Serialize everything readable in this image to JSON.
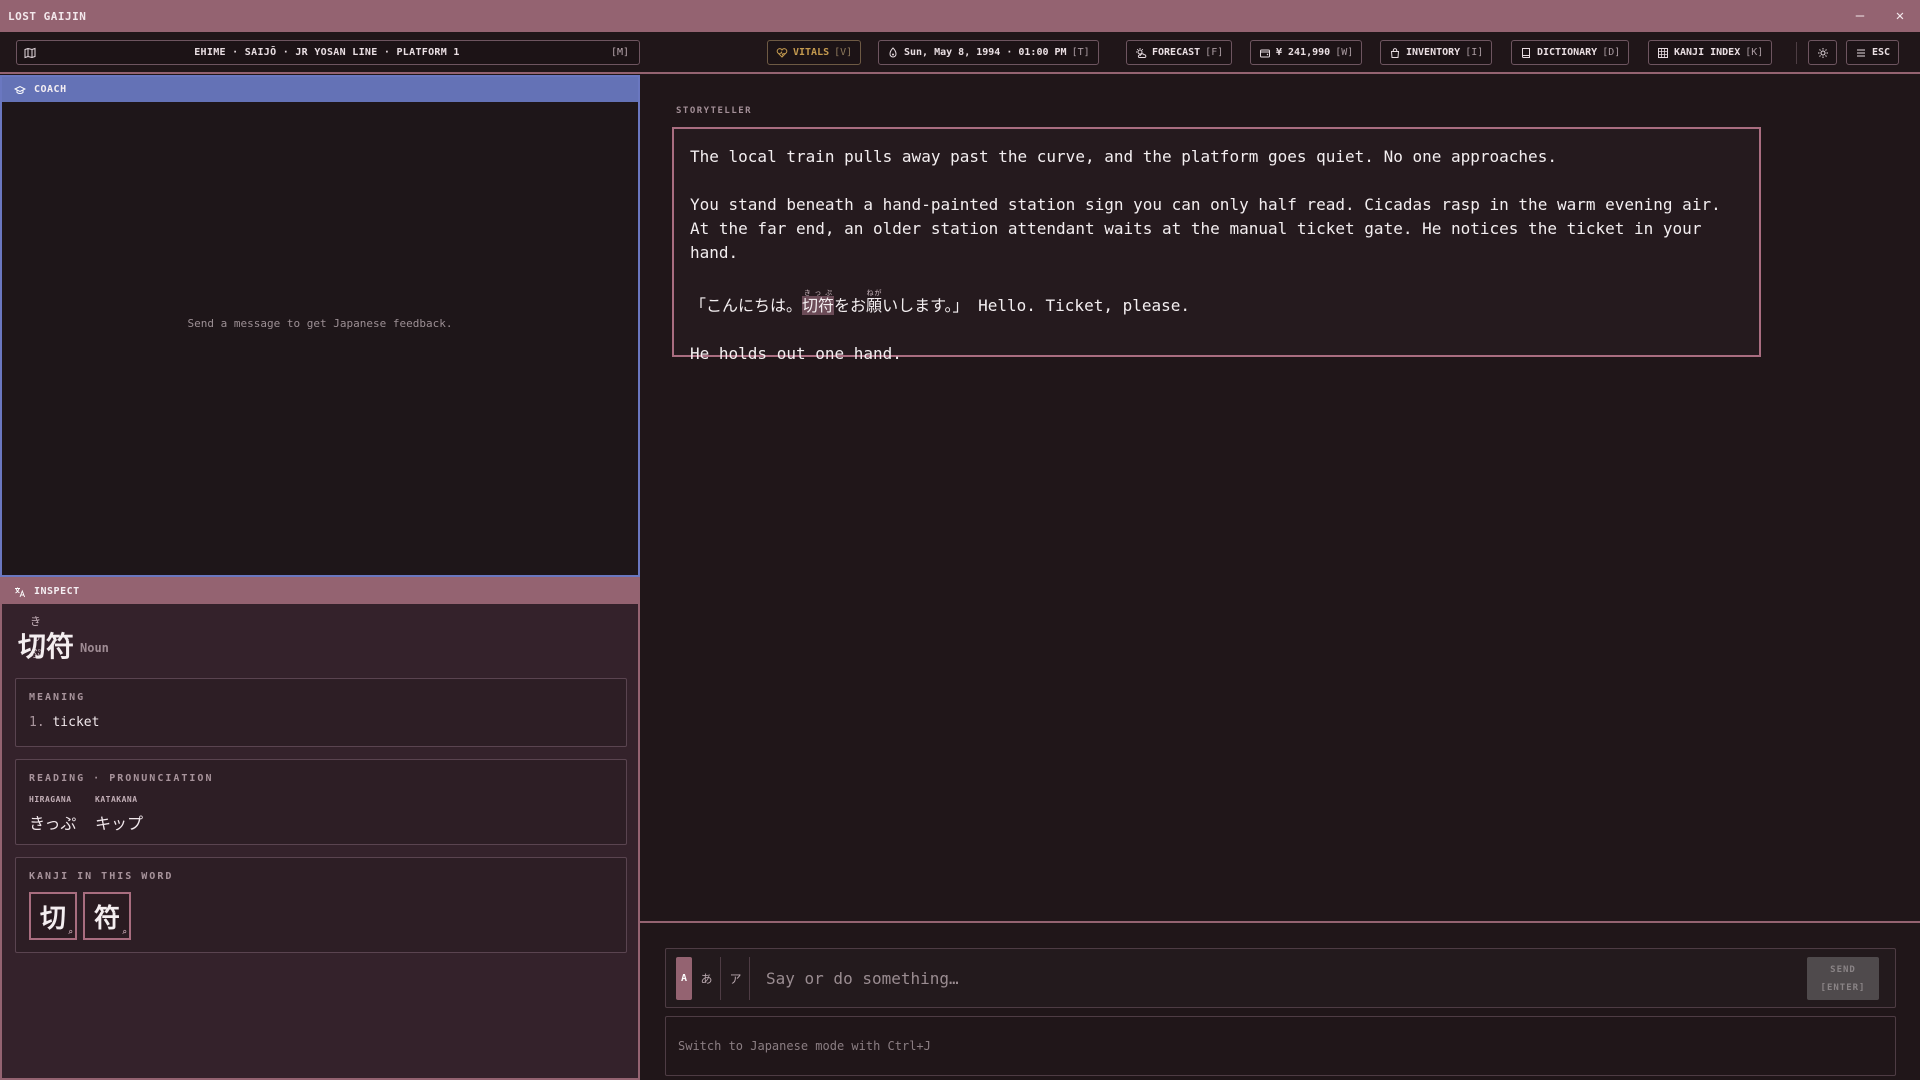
{
  "window": {
    "title": "LOST GAIJIN",
    "minimize_glyph": "—",
    "close_glyph": "✕"
  },
  "toolbar": {
    "location": {
      "text": "EHIME · SAIJŌ · JR YOSAN LINE · PLATFORM 1",
      "key": "[M]",
      "icon": "map-icon"
    },
    "vitals": {
      "label": "VITALS",
      "key": "[V]",
      "icon": "heart-icon",
      "color": "#c49a4f"
    },
    "time": {
      "label": "Sun, May 8, 1994 · 01:00 PM",
      "key": "[T]",
      "icon": "clock-icon"
    },
    "forecast": {
      "label": "FORECAST",
      "key": "[F]",
      "icon": "sun-cloud-icon"
    },
    "wallet": {
      "label": "¥ 241,990",
      "key": "[W]",
      "icon": "wallet-icon"
    },
    "inventory": {
      "label": "INVENTORY",
      "key": "[I]",
      "icon": "bag-icon"
    },
    "dictionary": {
      "label": "DICTIONARY",
      "key": "[D]",
      "icon": "book-icon"
    },
    "kanji_index": {
      "label": "KANJI INDEX",
      "key": "[K]",
      "icon": "grid-icon"
    },
    "settings": {
      "icon": "gear-icon"
    },
    "menu": {
      "label": "ESC",
      "icon": "menu-icon"
    }
  },
  "coach": {
    "title": "COACH",
    "icon": "graduation-cap-icon",
    "empty_text": "Send a message to get Japanese feedback.",
    "header_color": "#6472b6"
  },
  "inspect": {
    "title": "INSPECT",
    "icon": "translate-icon",
    "word": {
      "reading": "きっぷ",
      "kanji": "切符",
      "pos": "Noun"
    },
    "meaning": {
      "title": "MEANING",
      "items": [
        {
          "num": "1.",
          "text": "ticket"
        }
      ]
    },
    "reading": {
      "title": "READING · PRONUNCIATION",
      "hiragana_label": "HIRAGANA",
      "hiragana": "きっぷ",
      "katakana_label": "KATAKANA",
      "katakana": "キップ"
    },
    "kanji_section": {
      "title": "KANJI IN THIS WORD",
      "kanji": [
        "切",
        "符"
      ],
      "icon": "search-icon"
    }
  },
  "storyteller": {
    "label": "STORYTELLER",
    "p1": "The local train pulls away past the curve, and the platform goes quiet. No one approaches.",
    "p2": "You stand beneath a hand-painted station sign you can only half read. Cicadas rasp in the warm evening air. At the far end, an older station attendant waits at the manual ticket gate. He notices the ticket in your hand.",
    "p3": {
      "open": "「こんにちは。",
      "word1": "切符",
      "word1_ruby": "きっぷ",
      "mid": "をお",
      "word2": "願",
      "word2_ruby": "ねが",
      "close": "いします。」",
      "english": " Hello. Ticket, please."
    },
    "p4": "He holds out one hand."
  },
  "input": {
    "modes": [
      "A",
      "あ",
      "ア"
    ],
    "placeholder": "Say or do something…",
    "send_label": "SEND",
    "send_key": "[ENTER]",
    "hint": "Switch to Japanese mode with Ctrl+J"
  }
}
